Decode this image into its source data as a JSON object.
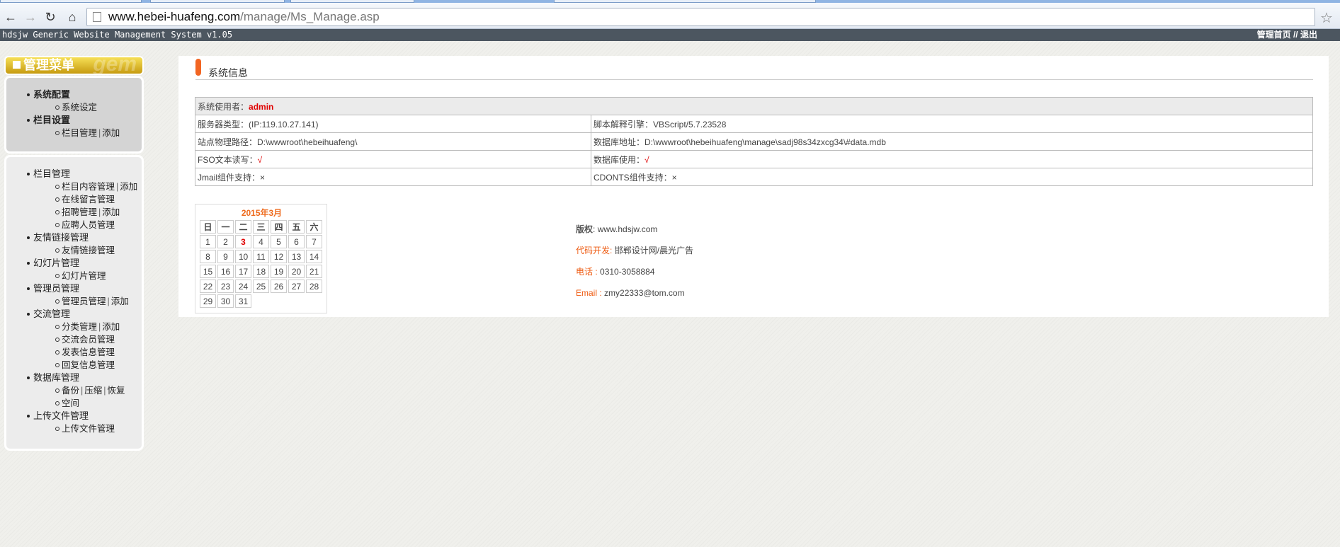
{
  "browser": {
    "url_host": "www.hebei-huafeng.com",
    "url_path": "/manage/Ms_Manage.asp"
  },
  "header": {
    "system_name": "hdsjw Generic Website Management System v1.05",
    "home_link": "管理首页",
    "sep": "//",
    "logout_link": "退出"
  },
  "menu": {
    "title": "管理菜单",
    "title_ghost": "gem",
    "box1": [
      {
        "label": "系统配置",
        "children": [
          {
            "label": "系统设定"
          }
        ]
      },
      {
        "label": "栏目设置",
        "children": [
          {
            "label": "栏目管理",
            "extra": "添加"
          }
        ]
      }
    ],
    "box2": [
      {
        "label": "栏目管理",
        "children": [
          {
            "label": "栏目内容管理",
            "extra": "添加"
          },
          {
            "label": "在线留言管理"
          },
          {
            "label": "招聘管理",
            "extra": "添加"
          },
          {
            "label": "应聘人员管理"
          }
        ]
      },
      {
        "label": "友情链接管理",
        "children": [
          {
            "label": "友情链接管理"
          }
        ]
      },
      {
        "label": "幻灯片管理",
        "children": [
          {
            "label": "幻灯片管理"
          }
        ]
      },
      {
        "label": "管理员管理",
        "children": [
          {
            "label": "管理员管理",
            "extra": "添加"
          }
        ]
      },
      {
        "label": "交流管理",
        "children": [
          {
            "label": "分类管理",
            "extra": "添加"
          },
          {
            "label": "交流会员管理"
          },
          {
            "label": "发表信息管理"
          },
          {
            "label": "回复信息管理"
          }
        ]
      },
      {
        "label": "数据库管理",
        "children": [
          {
            "label": "备份",
            "extra": "压缩",
            "extra2": "恢复"
          },
          {
            "label": "空间"
          }
        ]
      },
      {
        "label": "上传文件管理",
        "children": [
          {
            "label": "上传文件管理"
          }
        ]
      }
    ]
  },
  "info": {
    "title": "系统信息",
    "user_label": "系统使用者：",
    "user_value": "admin",
    "server_type": "服务器类型：(IP:119.10.27.141)",
    "script_engine": "脚本解释引擎：VBScript/5.7.23528",
    "site_path": "站点物理路径：D:\\wwwroot\\hebeihuafeng\\",
    "db_address": "数据库地址：D:\\wwwroot\\hebeihuafeng\\manage\\sadj98s34zxcg34\\#data.mdb",
    "fso_label": "FSO文本读写：",
    "fso_value": "√",
    "db_use_label": "数据库使用：",
    "db_use_value": "√",
    "jmail": "Jmail组件支持：×",
    "cdonts": "CDONTS组件支持：×"
  },
  "calendar": {
    "caption": "2015年3月",
    "weekdays": [
      "日",
      "一",
      "二",
      "三",
      "四",
      "五",
      "六"
    ],
    "today": "3",
    "weeks": [
      [
        "1",
        "2",
        "3",
        "4",
        "5",
        "6",
        "7"
      ],
      [
        "8",
        "9",
        "10",
        "11",
        "12",
        "13",
        "14"
      ],
      [
        "15",
        "16",
        "17",
        "18",
        "19",
        "20",
        "21"
      ],
      [
        "22",
        "23",
        "24",
        "25",
        "26",
        "27",
        "28"
      ],
      [
        "29",
        "30",
        "31",
        "",
        "",
        "",
        ""
      ]
    ]
  },
  "credits": {
    "copyright_label": "版权",
    "copyright_value": "www.hdsjw.com",
    "dev_label": "代码开发",
    "dev_value": "邯郸设计网/晨光广告",
    "phone_label": "电话",
    "phone_value": "0310-3058884",
    "email_label": "Email",
    "email_value": "zmy22333@tom.com"
  }
}
